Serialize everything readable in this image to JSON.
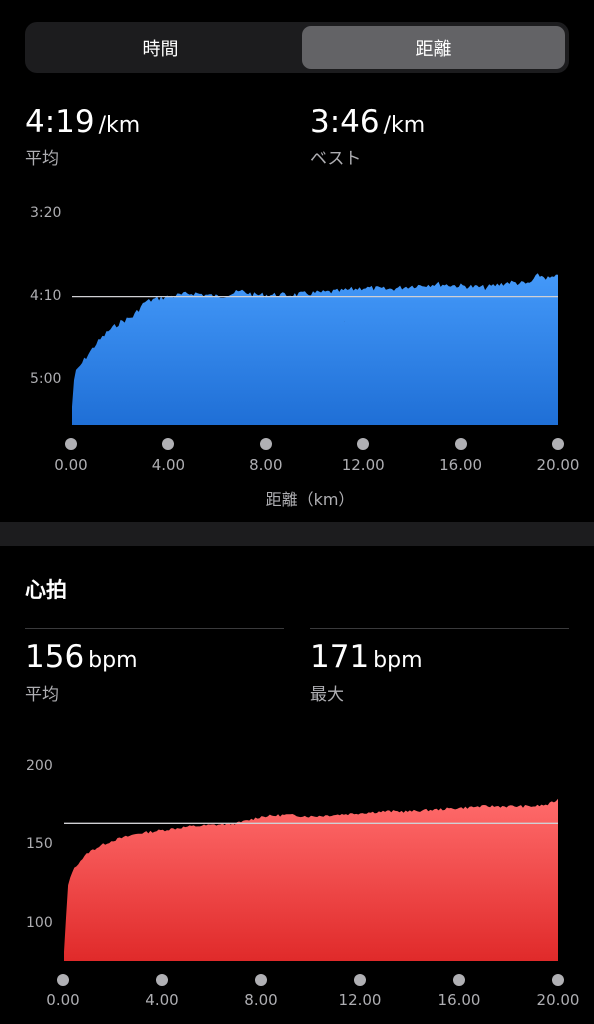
{
  "tabs": {
    "time_label": "時間",
    "distance_label": "距離",
    "selected": "距離"
  },
  "pace": {
    "avg_value": "4:19",
    "avg_unit": "/km",
    "avg_label": "平均",
    "best_value": "3:46",
    "best_unit": "/km",
    "best_label": "ベスト"
  },
  "heart": {
    "title": "心拍",
    "avg_value": "156",
    "avg_unit": "bpm",
    "avg_label": "平均",
    "max_value": "171",
    "max_unit": "bpm",
    "max_label": "最大"
  },
  "colors": {
    "pace_fill": "#2f82e6",
    "hr_fill": "#ee3b3b",
    "avg_line": "#d0d0d4"
  },
  "chart_data": [
    {
      "type": "area",
      "title": "",
      "xlabel": "距離（km）",
      "ylabel": "",
      "x_ticks": [
        "0.00",
        "4.00",
        "8.00",
        "12.00",
        "16.00",
        "20.00"
      ],
      "y_ticks": [
        "3:20",
        "4:10",
        "5:00"
      ],
      "xlim": [
        0,
        20
      ],
      "ylim_sec_per_km": [
        200,
        330
      ],
      "y_axis_reversed": true,
      "average_line_sec_per_km": 259,
      "x": [
        0,
        0.1,
        0.3,
        0.6,
        1.0,
        1.5,
        2.0,
        2.5,
        3.0,
        3.5,
        4.0,
        5.0,
        6.0,
        7.0,
        7.5,
        8.0,
        9.0,
        10.0,
        11.0,
        12.0,
        13.0,
        14.0,
        15.0,
        16.0,
        17.0,
        18.0,
        18.8,
        19.2,
        19.6,
        20.0
      ],
      "values": [
        320,
        302,
        298,
        292,
        285,
        278,
        273,
        270,
        262,
        260,
        259,
        257,
        259,
        256,
        258,
        258,
        258,
        257,
        256,
        254,
        255,
        253,
        252,
        253,
        254,
        251,
        252,
        247,
        249,
        248
      ],
      "spikes": [
        {
          "x": 0.05,
          "value": 330
        },
        {
          "x": 3.7,
          "value": 285
        },
        {
          "x": 7.5,
          "value": 240
        },
        {
          "x": 11.2,
          "value": 273
        },
        {
          "x": 14.8,
          "value": 232
        },
        {
          "x": 14.8,
          "value": 272
        }
      ]
    },
    {
      "type": "area",
      "title": "",
      "xlabel": "",
      "ylabel": "",
      "x_ticks": [
        "0.00",
        "4.00",
        "8.00",
        "12.00",
        "16.00",
        "20.00"
      ],
      "y_ticks": [
        "200",
        "150",
        "100"
      ],
      "xlim": [
        0,
        20
      ],
      "ylim": [
        75,
        205
      ],
      "average_line": 156,
      "x": [
        0,
        0.15,
        0.3,
        0.6,
        1.0,
        1.5,
        2.0,
        2.5,
        3.0,
        3.5,
        4.0,
        5.0,
        6.0,
        7.0,
        8.0,
        9.0,
        10.0,
        11.0,
        12.0,
        13.0,
        14.0,
        15.0,
        16.0,
        17.0,
        18.0,
        19.0,
        19.6,
        20.0
      ],
      "values": [
        80,
        118,
        127,
        133,
        139,
        143,
        146,
        148,
        150,
        151,
        152,
        154,
        155,
        156,
        160,
        161,
        160,
        161,
        162,
        163,
        163,
        164,
        165,
        166,
        166,
        166,
        167,
        170
      ]
    }
  ]
}
